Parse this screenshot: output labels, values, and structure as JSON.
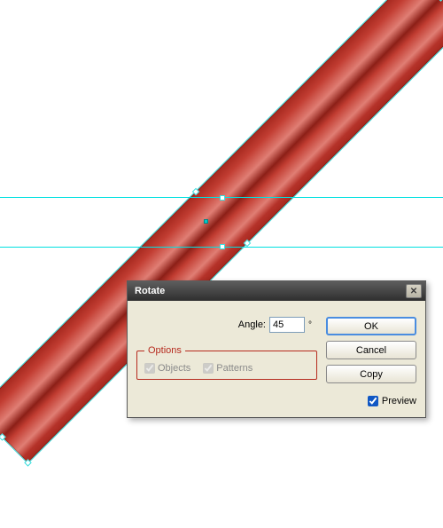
{
  "dialog": {
    "title": "Rotate",
    "angle_label": "Angle:",
    "angle_value": "45",
    "degree_symbol": "°",
    "options_legend": "Options",
    "objects_label": "Objects",
    "patterns_label": "Patterns",
    "buttons": {
      "ok": "OK",
      "cancel": "Cancel",
      "copy": "Copy"
    },
    "preview_label": "Preview"
  }
}
